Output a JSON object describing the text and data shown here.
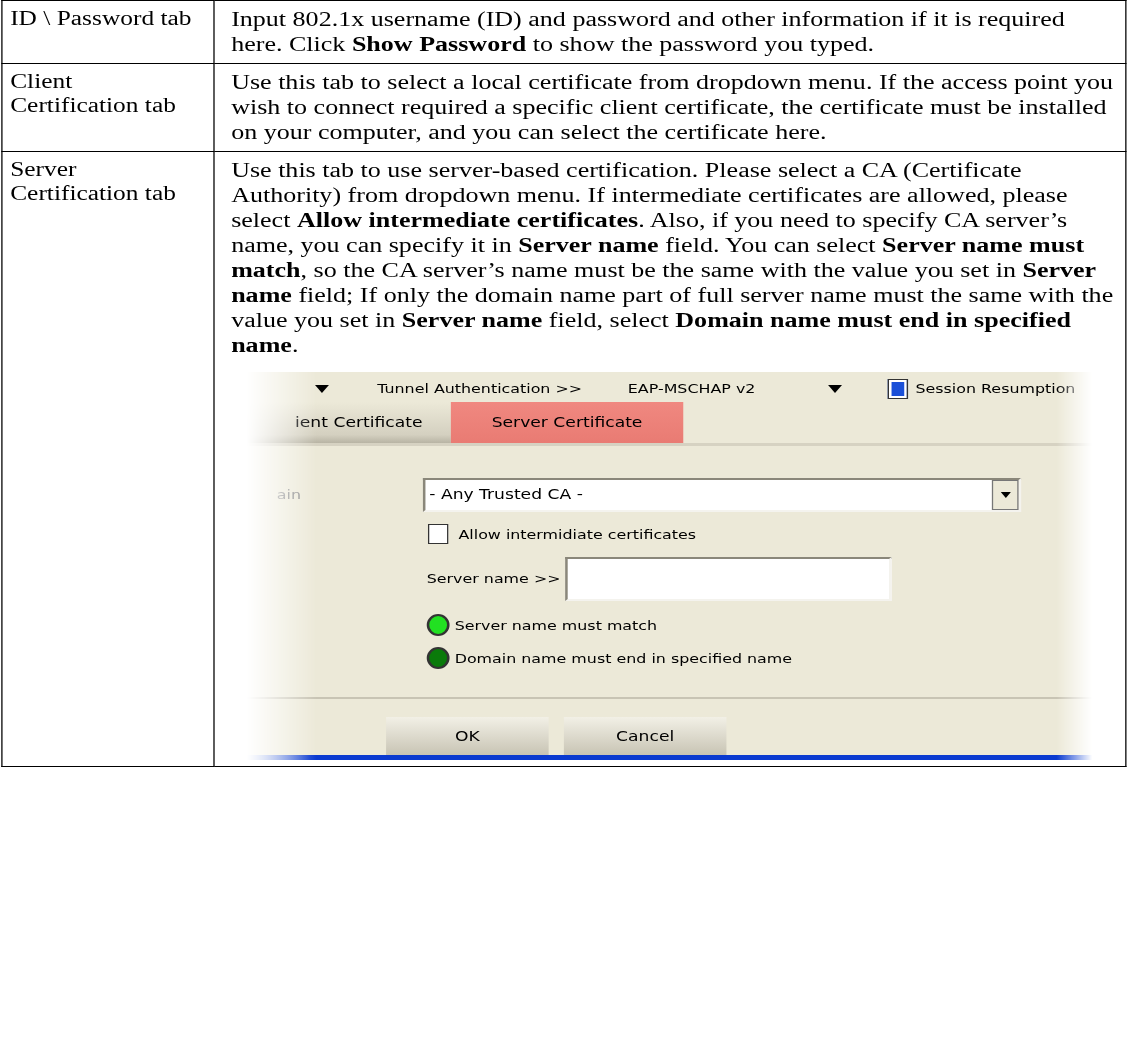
{
  "table": {
    "rows": [
      {
        "term": "ID \\ Password tab",
        "description": "Input 802.1x username (ID) and password and other information if it is required here. Click **Show Password** to show the password you typed."
      },
      {
        "term": "Client Certification tab",
        "description": "Use this tab to select a local certificate from dropdown menu. If the access point you wish to connect required a specific client certificate, the certificate must be installed on your computer, and you can select the certificate here."
      },
      {
        "term": "Server Certification tab",
        "description": "Use this tab to use server-based certification. Please select a CA (Certificate Authority) from dropdown menu. If intermediate certificates are allowed, please select **Allow intermediate certificates**. Also, if you need to specify CA server’s name, you can specify it in **Server name** field. You can select **Server name must match**, so the CA server’s name must be the same with the value you set in **Server name** field; If only the domain name part of full server name must the same with the value you set in **Server name** field, select **Domain name must end in specified name**.",
        "screenshot": {
          "top_bar": {
            "tunnel_label": "Tunnel Authentication >>",
            "tunnel_value": "EAP-MSCHAP v2",
            "session_resumption": {
              "label": "Session Resumption",
              "checked": true
            }
          },
          "tabs": [
            {
              "label": "ient Certificate",
              "selected": false
            },
            {
              "label": "Server Certificate",
              "selected": true
            }
          ],
          "ca_label": "ain",
          "ca_select": "- Any Trusted CA -",
          "allow_intermediate": {
            "label": "Allow intermidiate certificates",
            "checked": false
          },
          "server_name_label": "Server name >>",
          "options": [
            {
              "label": "Server name must match",
              "selected": true
            },
            {
              "label": "Domain name must end in specified name",
              "selected": false
            }
          ],
          "buttons": [
            "OK",
            "Cancel"
          ]
        }
      }
    ]
  }
}
